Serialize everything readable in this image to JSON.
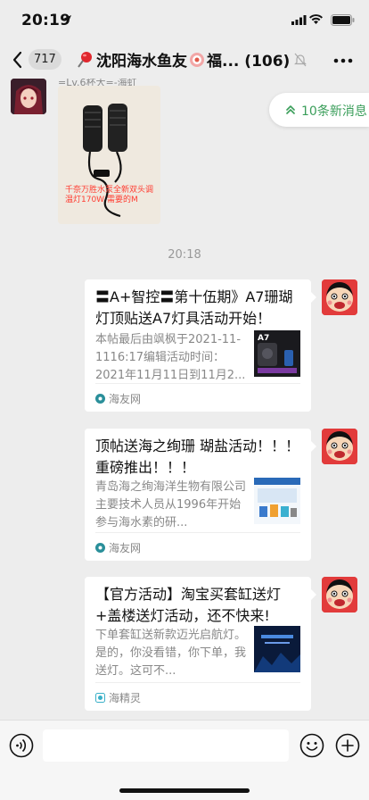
{
  "status_bar": {
    "time": "20:19"
  },
  "nav": {
    "back_count": "717",
    "title": "沈阳海水鱼友",
    "title_suffix": "福...",
    "member_count": "(106)"
  },
  "chat": {
    "top_message": {
      "sender_label": "=Lv.6杯大=-海虹",
      "image_caption": "千奈万胜水泵全新双头调温灯170W 需要的M"
    },
    "new_messages_pill": "10条新消息",
    "timestamp": "20:18",
    "cards": [
      {
        "title": "〓A+智控〓第十伍期》A7珊瑚灯顶贴送A7灯具活动开始！",
        "desc": "本帖最后由飒枫于2021-11-1116:17编辑活动时间：2021年11月11日到11月2...",
        "thumb_label": "A7",
        "source": "海友网"
      },
      {
        "title": "顶帖送海之绚珊 瑚盐活动！！！ 重磅推出！！！",
        "desc": "青岛海之绚海洋生物有限公司主要技术人员从1996年开始参与海水素的研...",
        "source": "海友网"
      },
      {
        "title": "【官方活动】淘宝买套缸送灯+盖楼送灯活动，还不快来!",
        "desc": "下单套缸送新款迈光启航灯。是的，你没看错，你下单，我送灯。这可不...",
        "source": "海精灵"
      }
    ]
  },
  "colors": {
    "accent_green": "#3a9e5a",
    "background": "#ededed"
  },
  "icons": {
    "back": "chevron-left-icon",
    "mute": "bell-slash-icon",
    "more": "more-dots-icon",
    "voice": "voice-icon",
    "emoji": "emoji-icon",
    "plus": "plus-circle-icon"
  }
}
